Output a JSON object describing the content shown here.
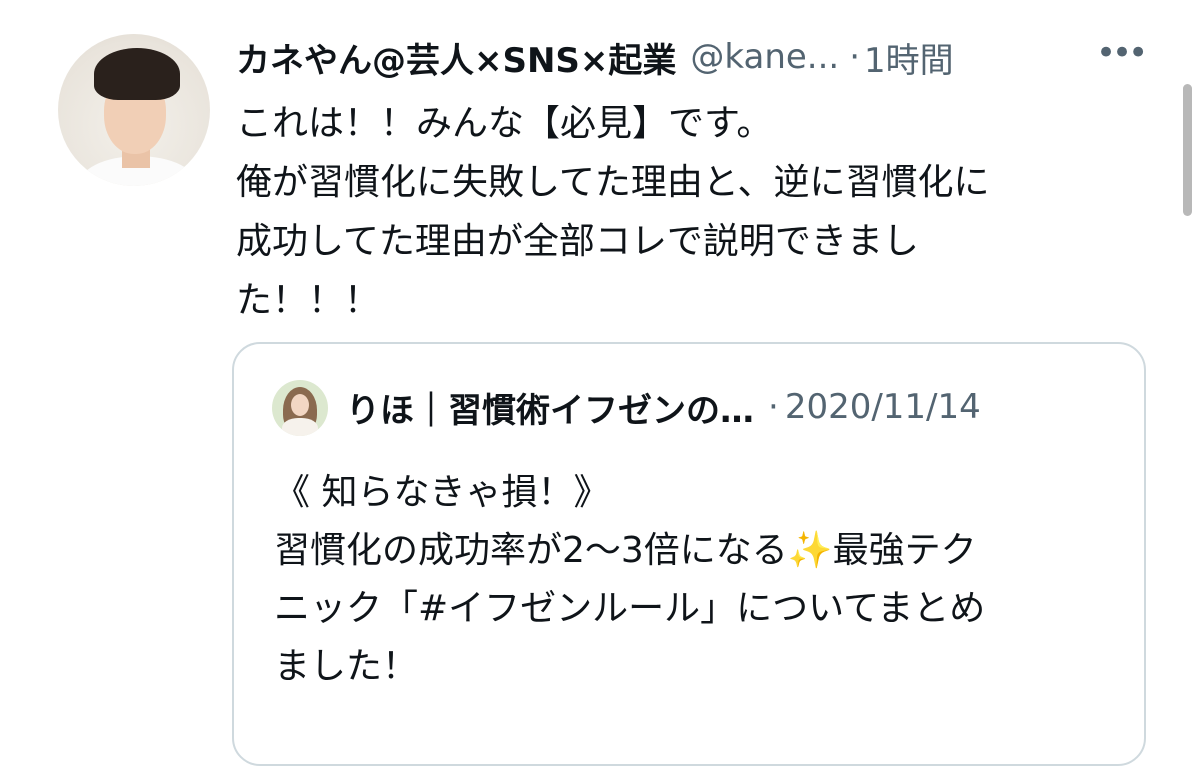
{
  "tweet": {
    "name": "カネやん@芸人×SNS×起業",
    "handle": "@kane...",
    "separator": "·",
    "time": "1時間",
    "more_icon": "•••",
    "text": "これは！！みんな【必見】です。\n俺が習慣化に失敗してた理由と、逆に習慣化に\n成功してた理由が全部コレで説明できまし\nた！！！"
  },
  "quoted": {
    "name": "りほ｜習慣術イフゼンの…",
    "separator": "·",
    "date": "2020/11/14",
    "text": "《 知らなきゃ損！》\n習慣化の成功率が2〜3倍になる✨最強テク\nニック「#イフゼンルール」についてまとめ\nました！"
  },
  "icons": {
    "avatar": "user-avatar-photo",
    "quoted_avatar": "quoted-user-avatar-photo",
    "more": "more-options-icon"
  },
  "colors": {
    "text": "#0f1419",
    "secondary": "#536471",
    "border": "#cfd9de"
  }
}
